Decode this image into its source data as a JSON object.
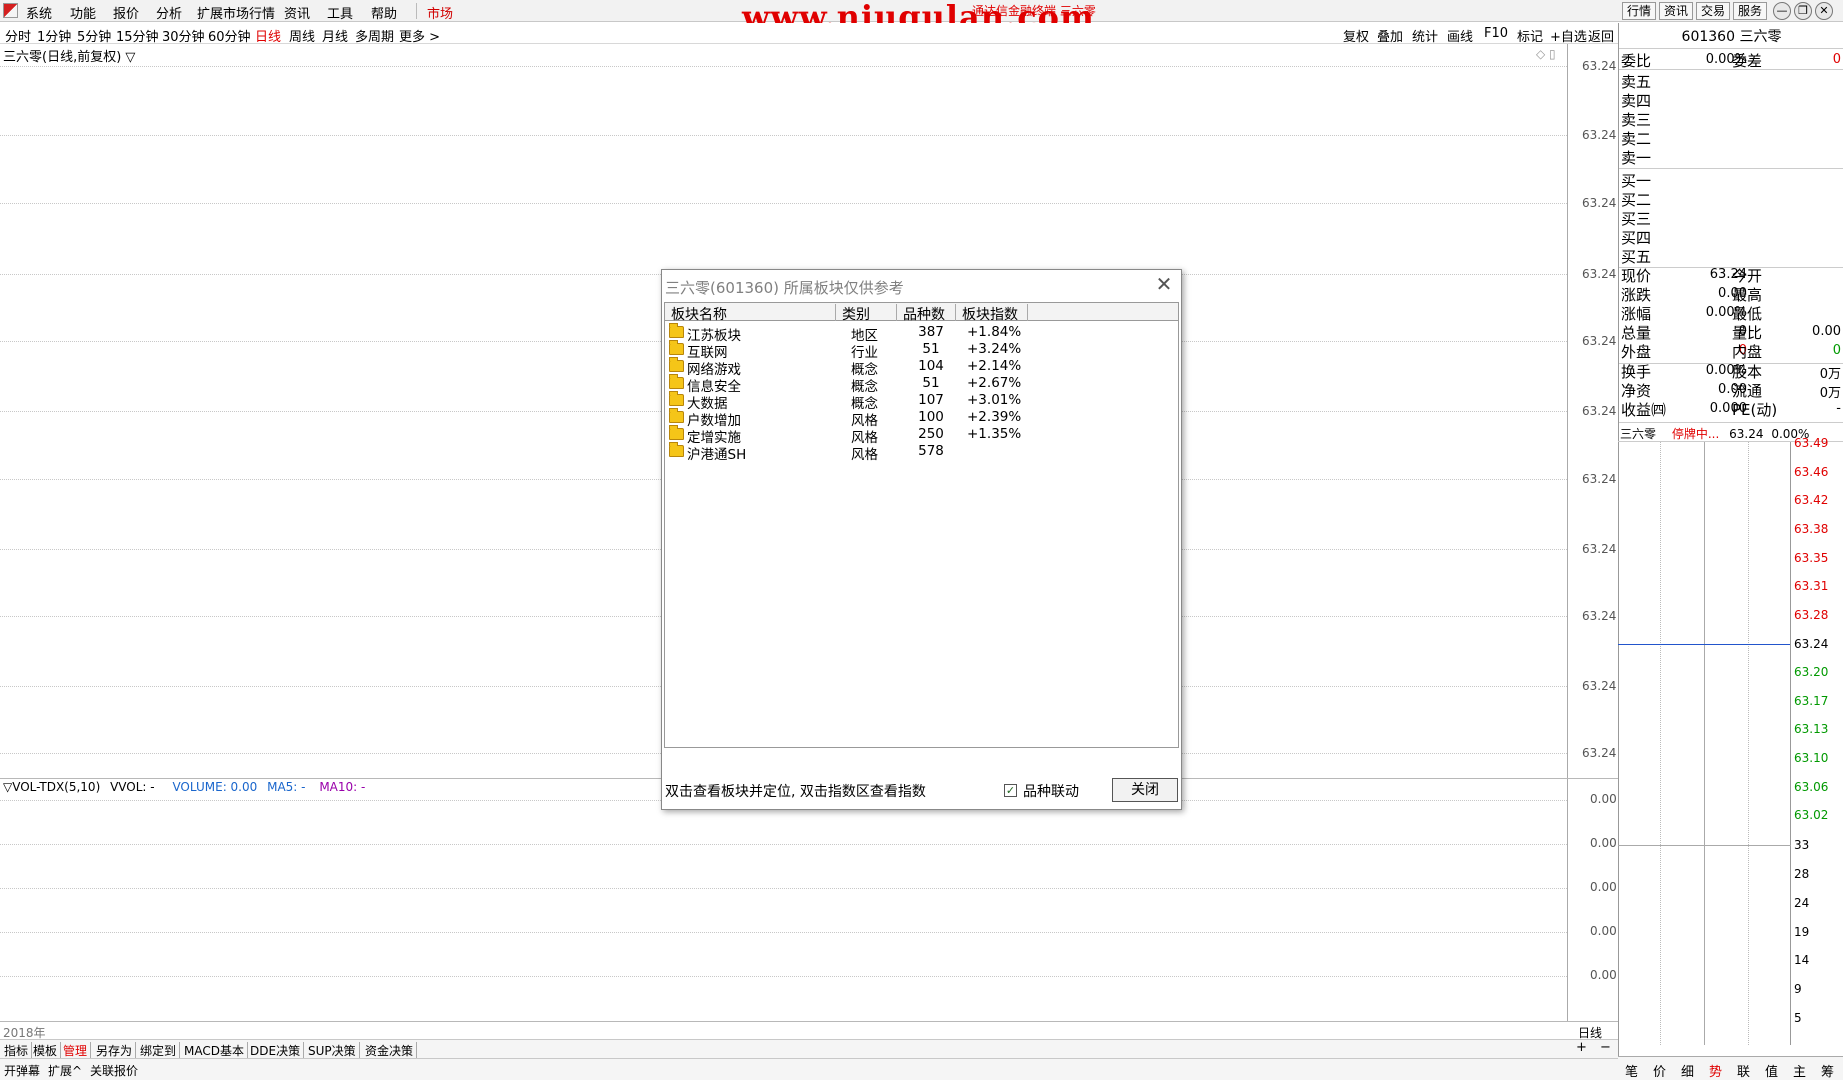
{
  "menu": {
    "items": [
      "系统",
      "功能",
      "报价",
      "分析",
      "扩展市场行情",
      "资讯",
      "工具",
      "帮助"
    ],
    "market": "市场",
    "watermark": "www.niugulan.com",
    "window_title": "通达信金融终端 三六零",
    "right_buttons": [
      "行情",
      "资讯",
      "交易",
      "服务"
    ]
  },
  "periods": {
    "items": [
      "分时",
      "1分钟",
      "5分钟",
      "15分钟",
      "30分钟",
      "60分钟",
      "日线",
      "周线",
      "月线",
      "多周期",
      "更多 >"
    ],
    "active": "日线"
  },
  "chart_tools": [
    "复权",
    "叠加",
    "统计",
    "画线",
    "F10",
    "标记",
    "+自选",
    "返回"
  ],
  "chart": {
    "title": "三六零(日线,前复权) ▽",
    "price_labels": [
      "63.24",
      "63.24",
      "63.24",
      "63.24",
      "63.24",
      "63.24",
      "63.24",
      "63.24",
      "63.24",
      "63.24",
      "63.24"
    ],
    "volume_header": {
      "name": "▽VOL-TDX(5,10)",
      "vvol": "VVOL: -",
      "volume": "VOLUME: 0.00",
      "ma5": "MA5: -",
      "ma10": "MA10: -"
    },
    "volume_labels": [
      "0.00",
      "0.00",
      "0.00",
      "0.00",
      "0.00"
    ],
    "year": "2018年",
    "period_label": "日线"
  },
  "bottom_tabs": {
    "items": [
      "指标",
      "模板",
      "管理",
      "另存为",
      "绑定到",
      "MACD基本",
      "DDE决策",
      "SUP决策",
      "资金决策"
    ],
    "active": "管理",
    "zoom_in": "+",
    "zoom_out": "−"
  },
  "status_bar": [
    "开弹幕",
    "扩展^",
    "关联报价"
  ],
  "quote": {
    "code_name": "601360 三六零",
    "weibi_label": "委比",
    "weibi": "0.00%",
    "weicha_label": "委差",
    "weicha": "0",
    "sell_levels": [
      "卖五",
      "卖四",
      "卖三",
      "卖二",
      "卖一"
    ],
    "buy_levels": [
      "买一",
      "买二",
      "买三",
      "买四",
      "买五"
    ],
    "fields": [
      {
        "l1": "现价",
        "v1": "63.24",
        "l2": "今开",
        "v2": ""
      },
      {
        "l1": "涨跌",
        "v1": "0.00",
        "l2": "最高",
        "v2": ""
      },
      {
        "l1": "涨幅",
        "v1": "0.00%",
        "l2": "最低",
        "v2": ""
      },
      {
        "l1": "总量",
        "v1": "0",
        "l2": "量比",
        "v2": "0.00"
      },
      {
        "l1": "外盘",
        "v1": "0",
        "l2": "内盘",
        "v2": "0"
      }
    ],
    "fields2": [
      {
        "l1": "换手",
        "v1": "0.00%",
        "l2": "股本",
        "v2": "0万"
      },
      {
        "l1": "净资",
        "v1": "0.00",
        "l2": "流通",
        "v2": "0万"
      },
      {
        "l1": "收益㈣",
        "v1": "0.000",
        "l2": "PE(动)",
        "v2": "-"
      }
    ]
  },
  "mini_chart": {
    "name": "三六零",
    "status": "停牌中...",
    "price": "63.24",
    "change": "0.00%",
    "price_labels": [
      "63.49",
      "63.46",
      "63.42",
      "63.38",
      "63.35",
      "63.31",
      "63.28",
      "63.24",
      "63.20",
      "63.17",
      "63.13",
      "63.10",
      "63.06",
      "63.02"
    ],
    "volume_labels": [
      "33",
      "28",
      "24",
      "19",
      "14",
      "9",
      "5"
    ],
    "tabs": [
      "笔",
      "价",
      "细",
      "势",
      "联",
      "值",
      "主",
      "筹"
    ],
    "active_tab": "势"
  },
  "dialog": {
    "title": "三六零(601360)  所属板块仅供参考",
    "close_symbol": "✕",
    "columns": [
      "板块名称",
      "类别",
      "品种数",
      "板块指数"
    ],
    "rows": [
      {
        "name": "江苏板块",
        "category": "地区",
        "count": "387",
        "index": "+1.84%"
      },
      {
        "name": "互联网",
        "category": "行业",
        "count": "51",
        "index": "+3.24%"
      },
      {
        "name": "网络游戏",
        "category": "概念",
        "count": "104",
        "index": "+2.14%"
      },
      {
        "name": "信息安全",
        "category": "概念",
        "count": "51",
        "index": "+2.67%"
      },
      {
        "name": "大数据",
        "category": "概念",
        "count": "107",
        "index": "+3.01%"
      },
      {
        "name": "户数增加",
        "category": "风格",
        "count": "100",
        "index": "+2.39%"
      },
      {
        "name": "定增实施",
        "category": "风格",
        "count": "250",
        "index": "+1.35%"
      },
      {
        "name": "沪港通SH",
        "category": "风格",
        "count": "578",
        "index": ""
      }
    ],
    "hint": "双击查看板块并定位, 双击指数区查看指数",
    "checkbox_label": "品种联动",
    "checkbox_checked": true,
    "close_button": "关闭"
  },
  "colors": {
    "accent_red": "#e00000",
    "down_green": "#009900",
    "price_line_blue": "#2255cc",
    "volume_blue": "#1a66cc",
    "ma10_purple": "#9900aa"
  }
}
